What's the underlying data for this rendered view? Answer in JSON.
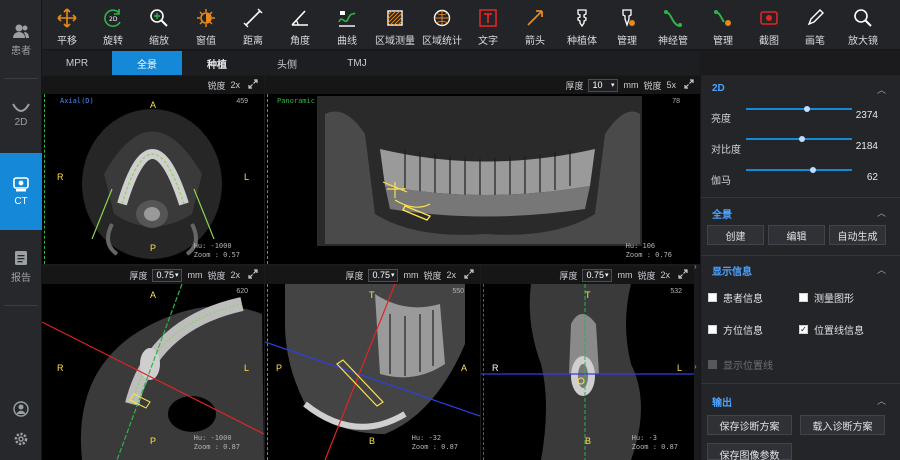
{
  "leftnav": {
    "patient": "患者",
    "d2": "2D",
    "ct": "CT",
    "report": "报告"
  },
  "toolbar": [
    {
      "label": "平移",
      "icon": "pan-icon"
    },
    {
      "label": "旋转",
      "icon": "rotate-icon"
    },
    {
      "label": "缩放",
      "icon": "zoom-icon"
    },
    {
      "label": "窗值",
      "icon": "window-level-icon"
    },
    {
      "label": "距离",
      "icon": "ruler-icon"
    },
    {
      "label": "角度",
      "icon": "angle-icon"
    },
    {
      "label": "曲线",
      "icon": "curve-icon"
    },
    {
      "label": "区域测量",
      "icon": "area-measure-icon"
    },
    {
      "label": "区域统计",
      "icon": "area-stat-icon"
    },
    {
      "label": "文字",
      "icon": "text-icon"
    },
    {
      "label": "箭头",
      "icon": "arrow-icon"
    },
    {
      "label": "种植体",
      "icon": "implant-icon"
    },
    {
      "label": "管理",
      "icon": "implant-manage-icon"
    },
    {
      "label": "神经管",
      "icon": "nerve-canal-icon"
    },
    {
      "label": "管理",
      "icon": "nerve-manage-icon"
    },
    {
      "label": "截图",
      "icon": "screenshot-icon"
    },
    {
      "label": "画笔",
      "icon": "pen-icon"
    },
    {
      "label": "放大镜",
      "icon": "magnifier-icon"
    }
  ],
  "tabs": [
    "MPR",
    "全景",
    "种植",
    "头侧",
    "TMJ"
  ],
  "viewports": {
    "axial": {
      "header_label": "锐度",
      "header_value": "2x",
      "corner_tl": "Axial(D)",
      "corner_tr": "459",
      "top": "A",
      "bottom": "P",
      "left": "R",
      "right": "L",
      "hu": "Hu: -1000",
      "zoom": "Zoom : 0.57"
    },
    "panoramic": {
      "thick_label": "厚度",
      "thick_value": "10",
      "unit": "mm",
      "sharp_label": "锐度",
      "sharp_value": "5x",
      "corner_tl": "Panoramic",
      "corner_tr": "78",
      "hu": "Hu: 106",
      "zoom": "Zoom : 0.76"
    },
    "view3": {
      "thick_label": "厚度",
      "thick_value": "0.75",
      "unit": "mm",
      "sharp_label": "锐度",
      "sharp_value": "2x",
      "corner_tr": "620",
      "top": "A",
      "bottom": "P",
      "left": "R",
      "right": "L",
      "hu": "Hu: -1000",
      "zoom": "Zoom : 0.87"
    },
    "view4": {
      "thick_label": "厚度",
      "thick_value": "0.75",
      "unit": "mm",
      "sharp_label": "锐度",
      "sharp_value": "2x",
      "corner_tr": "550",
      "top": "T",
      "bottom": "B",
      "left": "P",
      "right": "A",
      "hu": "Hu: -32",
      "zoom": "Zoom : 0.87"
    },
    "view5": {
      "thick_label": "厚度",
      "thick_value": "0.75",
      "unit": "mm",
      "sharp_label": "锐度",
      "sharp_value": "2x",
      "corner_tr": "532",
      "top": "T",
      "bottom": "B",
      "left": "R",
      "right": "L",
      "hu": "Hu: -3",
      "zoom": "Zoom : 0.87"
    }
  },
  "panel": {
    "sec2d": "2D",
    "brightness_label": "亮度",
    "brightness_value": "2374",
    "contrast_label": "对比度",
    "contrast_value": "2184",
    "gamma_label": "伽马",
    "gamma_value": "62",
    "sliders": {
      "brightness": 0.55,
      "contrast": 0.5,
      "gamma": 0.6
    },
    "secpano": "全景",
    "btn_create": "创建",
    "btn_edit": "编辑",
    "btn_auto": "自动生成",
    "secdisplay": "显示信息",
    "cb_patient": "患者信息",
    "cb_measure": "测量图形",
    "cb_orient": "方位信息",
    "cb_position": "位置线信息",
    "cb_disabled": "显示位置线",
    "checks": {
      "patient": false,
      "measure": false,
      "orient": false,
      "position": true
    },
    "secout": "输出",
    "btn_save": "保存诊断方案",
    "btn_load": "载入诊断方案",
    "btn_saveimg": "保存图像参数"
  },
  "colors": {
    "accent": "#1688d8",
    "marker_yellow": "#ffe14d",
    "line_green": "#2fb34a",
    "line_red": "#e02424",
    "line_blue": "#2f3fe0"
  }
}
